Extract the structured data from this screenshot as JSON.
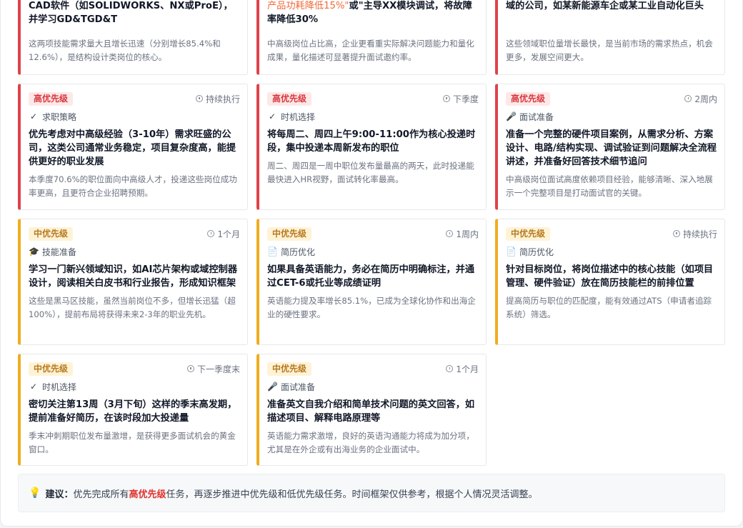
{
  "top_cards": [
    {
      "title": "CAD软件（如SOLIDWORKS、NX或ProE），并学习GD&TGD&T",
      "desc": "这两项技能需求量大且增长迅速（分别增长85.4%和12.6%），是结构设计类岗位的核心。"
    },
    {
      "title_highlight": "产品功耗降低15%\"",
      "title_rest": "或\"主导XX模块调试，将故障率降低30%",
      "desc": "中高级岗位占比高，企业更看重实际解决问题能力和量化成果，量化描述可显著提升面试邀约率。"
    },
    {
      "title": "域的公司，如某新能源车企或某工业自动化巨头",
      "desc": "这些领域职位量增长最快，是当前市场的需求热点，机会更多，发展空间更大。"
    }
  ],
  "cards": [
    {
      "priority": "高优先级",
      "level": "high",
      "time": "持续执行",
      "category_icon": "check-icon",
      "category_glyph": "✓",
      "category": "求职策略",
      "title": "优先考虑对中高级经验（3-10年）需求旺盛的公司，这类公司通常业务稳定，项目复杂度高，能提供更好的职业发展",
      "desc": "本季度70.6%的职位面向中高级人才，投递这些岗位成功率更高，且更符合企业招聘预期。"
    },
    {
      "priority": "高优先级",
      "level": "high",
      "time": "下季度",
      "category_icon": "check-icon",
      "category_glyph": "✓",
      "category": "时机选择",
      "title": "将每周二、周四上午9:00-11:00作为核心投递时段，集中投递本周新发布的职位",
      "desc": "周二、周四是一周中职位发布量最高的两天，此时投递能最快进入HR视野，面试转化率最高。"
    },
    {
      "priority": "高优先级",
      "level": "high",
      "time": "2周内",
      "category_icon": "microphone-icon",
      "category_glyph": "🎤",
      "category": "面试准备",
      "title": "准备一个完整的硬件项目案例，从需求分析、方案设计、电路/结构实现、调试验证到问题解决全流程讲述，并准备好回答技术细节追问",
      "desc": "中高级岗位面试高度依赖项目经验，能够清晰、深入地展示一个完整项目是打动面试官的关键。"
    },
    {
      "priority": "中优先级",
      "level": "mid",
      "time": "1个月",
      "category_icon": "graduation-cap-icon",
      "category_glyph": "🎓",
      "category": "技能准备",
      "title": "学习一门新兴领域知识，如AI芯片架构或域控制器设计，阅读相关白皮书和行业报告，形成知识框架",
      "desc": "这些是黑马区技能，虽然当前岗位不多，但增长迅猛（超100%），提前布局将获得未来2-3年的职业先机。"
    },
    {
      "priority": "中优先级",
      "level": "mid",
      "time": "1周内",
      "category_icon": "document-icon",
      "category_glyph": "📄",
      "category": "简历优化",
      "title": "如果具备英语能力，务必在简历中明确标注，并通过CET-6或托业等成绩证明",
      "desc": "英语能力提及率增长85.1%，已成为全球化协作和出海企业的硬性要求。"
    },
    {
      "priority": "中优先级",
      "level": "mid",
      "time": "持续执行",
      "category_icon": "document-icon",
      "category_glyph": "📄",
      "category": "简历优化",
      "title": "针对目标岗位，将岗位描述中的核心技能（如项目管理、硬件验证）放在简历技能栏的前排位置",
      "desc": "提高简历与职位的匹配度，能有效通过ATS（申请者追踪系统）筛选。"
    },
    {
      "priority": "中优先级",
      "level": "mid",
      "time": "下一季度末",
      "category_icon": "check-icon",
      "category_glyph": "✓",
      "category": "时机选择",
      "title": "密切关注第13周（3月下旬）这样的季末高发期，提前准备好简历，在该时段加大投递量",
      "desc": "季末冲刺期职位发布量激增，是获得更多面试机会的黄金窗口。"
    },
    {
      "priority": "中优先级",
      "level": "mid",
      "time": "1个月",
      "category_icon": "microphone-icon",
      "category_glyph": "🎤",
      "category": "面试准备",
      "title": "准备英文自我介绍和简单技术问题的英文回答，如描述项目、解释电路原理等",
      "desc": "英语能力需求激增，良好的英语沟通能力将成为加分项，尤其是在外企或有出海业务的企业面试中。"
    }
  ],
  "tip": {
    "icon": "lightbulb-icon",
    "lead": "建议：",
    "part1": "优先完成所有",
    "highlight": "高优先级",
    "part2": "任务，再逐步推进中优先级和低优先级任务。时间框架仅供参考，根据个人情况灵活调整。"
  }
}
